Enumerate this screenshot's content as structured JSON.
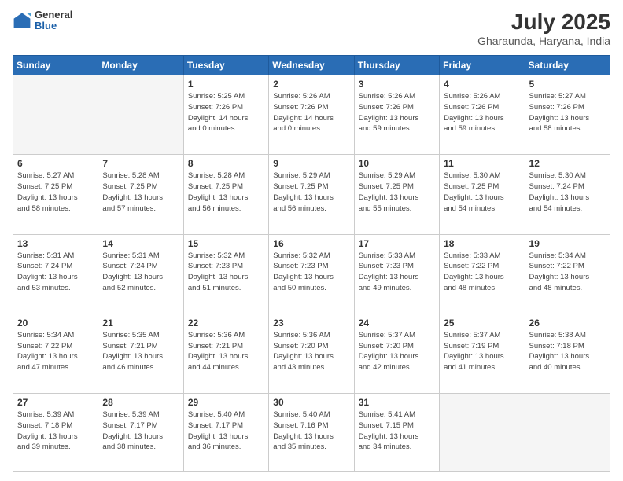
{
  "header": {
    "logo_general": "General",
    "logo_blue": "Blue",
    "month_year": "July 2025",
    "location": "Gharaunda, Haryana, India"
  },
  "days_of_week": [
    "Sunday",
    "Monday",
    "Tuesday",
    "Wednesday",
    "Thursday",
    "Friday",
    "Saturday"
  ],
  "weeks": [
    [
      {
        "day": "",
        "info": ""
      },
      {
        "day": "",
        "info": ""
      },
      {
        "day": "1",
        "info": "Sunrise: 5:25 AM\nSunset: 7:26 PM\nDaylight: 14 hours\nand 0 minutes."
      },
      {
        "day": "2",
        "info": "Sunrise: 5:26 AM\nSunset: 7:26 PM\nDaylight: 14 hours\nand 0 minutes."
      },
      {
        "day": "3",
        "info": "Sunrise: 5:26 AM\nSunset: 7:26 PM\nDaylight: 13 hours\nand 59 minutes."
      },
      {
        "day": "4",
        "info": "Sunrise: 5:26 AM\nSunset: 7:26 PM\nDaylight: 13 hours\nand 59 minutes."
      },
      {
        "day": "5",
        "info": "Sunrise: 5:27 AM\nSunset: 7:26 PM\nDaylight: 13 hours\nand 58 minutes."
      }
    ],
    [
      {
        "day": "6",
        "info": "Sunrise: 5:27 AM\nSunset: 7:25 PM\nDaylight: 13 hours\nand 58 minutes."
      },
      {
        "day": "7",
        "info": "Sunrise: 5:28 AM\nSunset: 7:25 PM\nDaylight: 13 hours\nand 57 minutes."
      },
      {
        "day": "8",
        "info": "Sunrise: 5:28 AM\nSunset: 7:25 PM\nDaylight: 13 hours\nand 56 minutes."
      },
      {
        "day": "9",
        "info": "Sunrise: 5:29 AM\nSunset: 7:25 PM\nDaylight: 13 hours\nand 56 minutes."
      },
      {
        "day": "10",
        "info": "Sunrise: 5:29 AM\nSunset: 7:25 PM\nDaylight: 13 hours\nand 55 minutes."
      },
      {
        "day": "11",
        "info": "Sunrise: 5:30 AM\nSunset: 7:25 PM\nDaylight: 13 hours\nand 54 minutes."
      },
      {
        "day": "12",
        "info": "Sunrise: 5:30 AM\nSunset: 7:24 PM\nDaylight: 13 hours\nand 54 minutes."
      }
    ],
    [
      {
        "day": "13",
        "info": "Sunrise: 5:31 AM\nSunset: 7:24 PM\nDaylight: 13 hours\nand 53 minutes."
      },
      {
        "day": "14",
        "info": "Sunrise: 5:31 AM\nSunset: 7:24 PM\nDaylight: 13 hours\nand 52 minutes."
      },
      {
        "day": "15",
        "info": "Sunrise: 5:32 AM\nSunset: 7:23 PM\nDaylight: 13 hours\nand 51 minutes."
      },
      {
        "day": "16",
        "info": "Sunrise: 5:32 AM\nSunset: 7:23 PM\nDaylight: 13 hours\nand 50 minutes."
      },
      {
        "day": "17",
        "info": "Sunrise: 5:33 AM\nSunset: 7:23 PM\nDaylight: 13 hours\nand 49 minutes."
      },
      {
        "day": "18",
        "info": "Sunrise: 5:33 AM\nSunset: 7:22 PM\nDaylight: 13 hours\nand 48 minutes."
      },
      {
        "day": "19",
        "info": "Sunrise: 5:34 AM\nSunset: 7:22 PM\nDaylight: 13 hours\nand 48 minutes."
      }
    ],
    [
      {
        "day": "20",
        "info": "Sunrise: 5:34 AM\nSunset: 7:22 PM\nDaylight: 13 hours\nand 47 minutes."
      },
      {
        "day": "21",
        "info": "Sunrise: 5:35 AM\nSunset: 7:21 PM\nDaylight: 13 hours\nand 46 minutes."
      },
      {
        "day": "22",
        "info": "Sunrise: 5:36 AM\nSunset: 7:21 PM\nDaylight: 13 hours\nand 44 minutes."
      },
      {
        "day": "23",
        "info": "Sunrise: 5:36 AM\nSunset: 7:20 PM\nDaylight: 13 hours\nand 43 minutes."
      },
      {
        "day": "24",
        "info": "Sunrise: 5:37 AM\nSunset: 7:20 PM\nDaylight: 13 hours\nand 42 minutes."
      },
      {
        "day": "25",
        "info": "Sunrise: 5:37 AM\nSunset: 7:19 PM\nDaylight: 13 hours\nand 41 minutes."
      },
      {
        "day": "26",
        "info": "Sunrise: 5:38 AM\nSunset: 7:18 PM\nDaylight: 13 hours\nand 40 minutes."
      }
    ],
    [
      {
        "day": "27",
        "info": "Sunrise: 5:39 AM\nSunset: 7:18 PM\nDaylight: 13 hours\nand 39 minutes."
      },
      {
        "day": "28",
        "info": "Sunrise: 5:39 AM\nSunset: 7:17 PM\nDaylight: 13 hours\nand 38 minutes."
      },
      {
        "day": "29",
        "info": "Sunrise: 5:40 AM\nSunset: 7:17 PM\nDaylight: 13 hours\nand 36 minutes."
      },
      {
        "day": "30",
        "info": "Sunrise: 5:40 AM\nSunset: 7:16 PM\nDaylight: 13 hours\nand 35 minutes."
      },
      {
        "day": "31",
        "info": "Sunrise: 5:41 AM\nSunset: 7:15 PM\nDaylight: 13 hours\nand 34 minutes."
      },
      {
        "day": "",
        "info": ""
      },
      {
        "day": "",
        "info": ""
      }
    ]
  ]
}
